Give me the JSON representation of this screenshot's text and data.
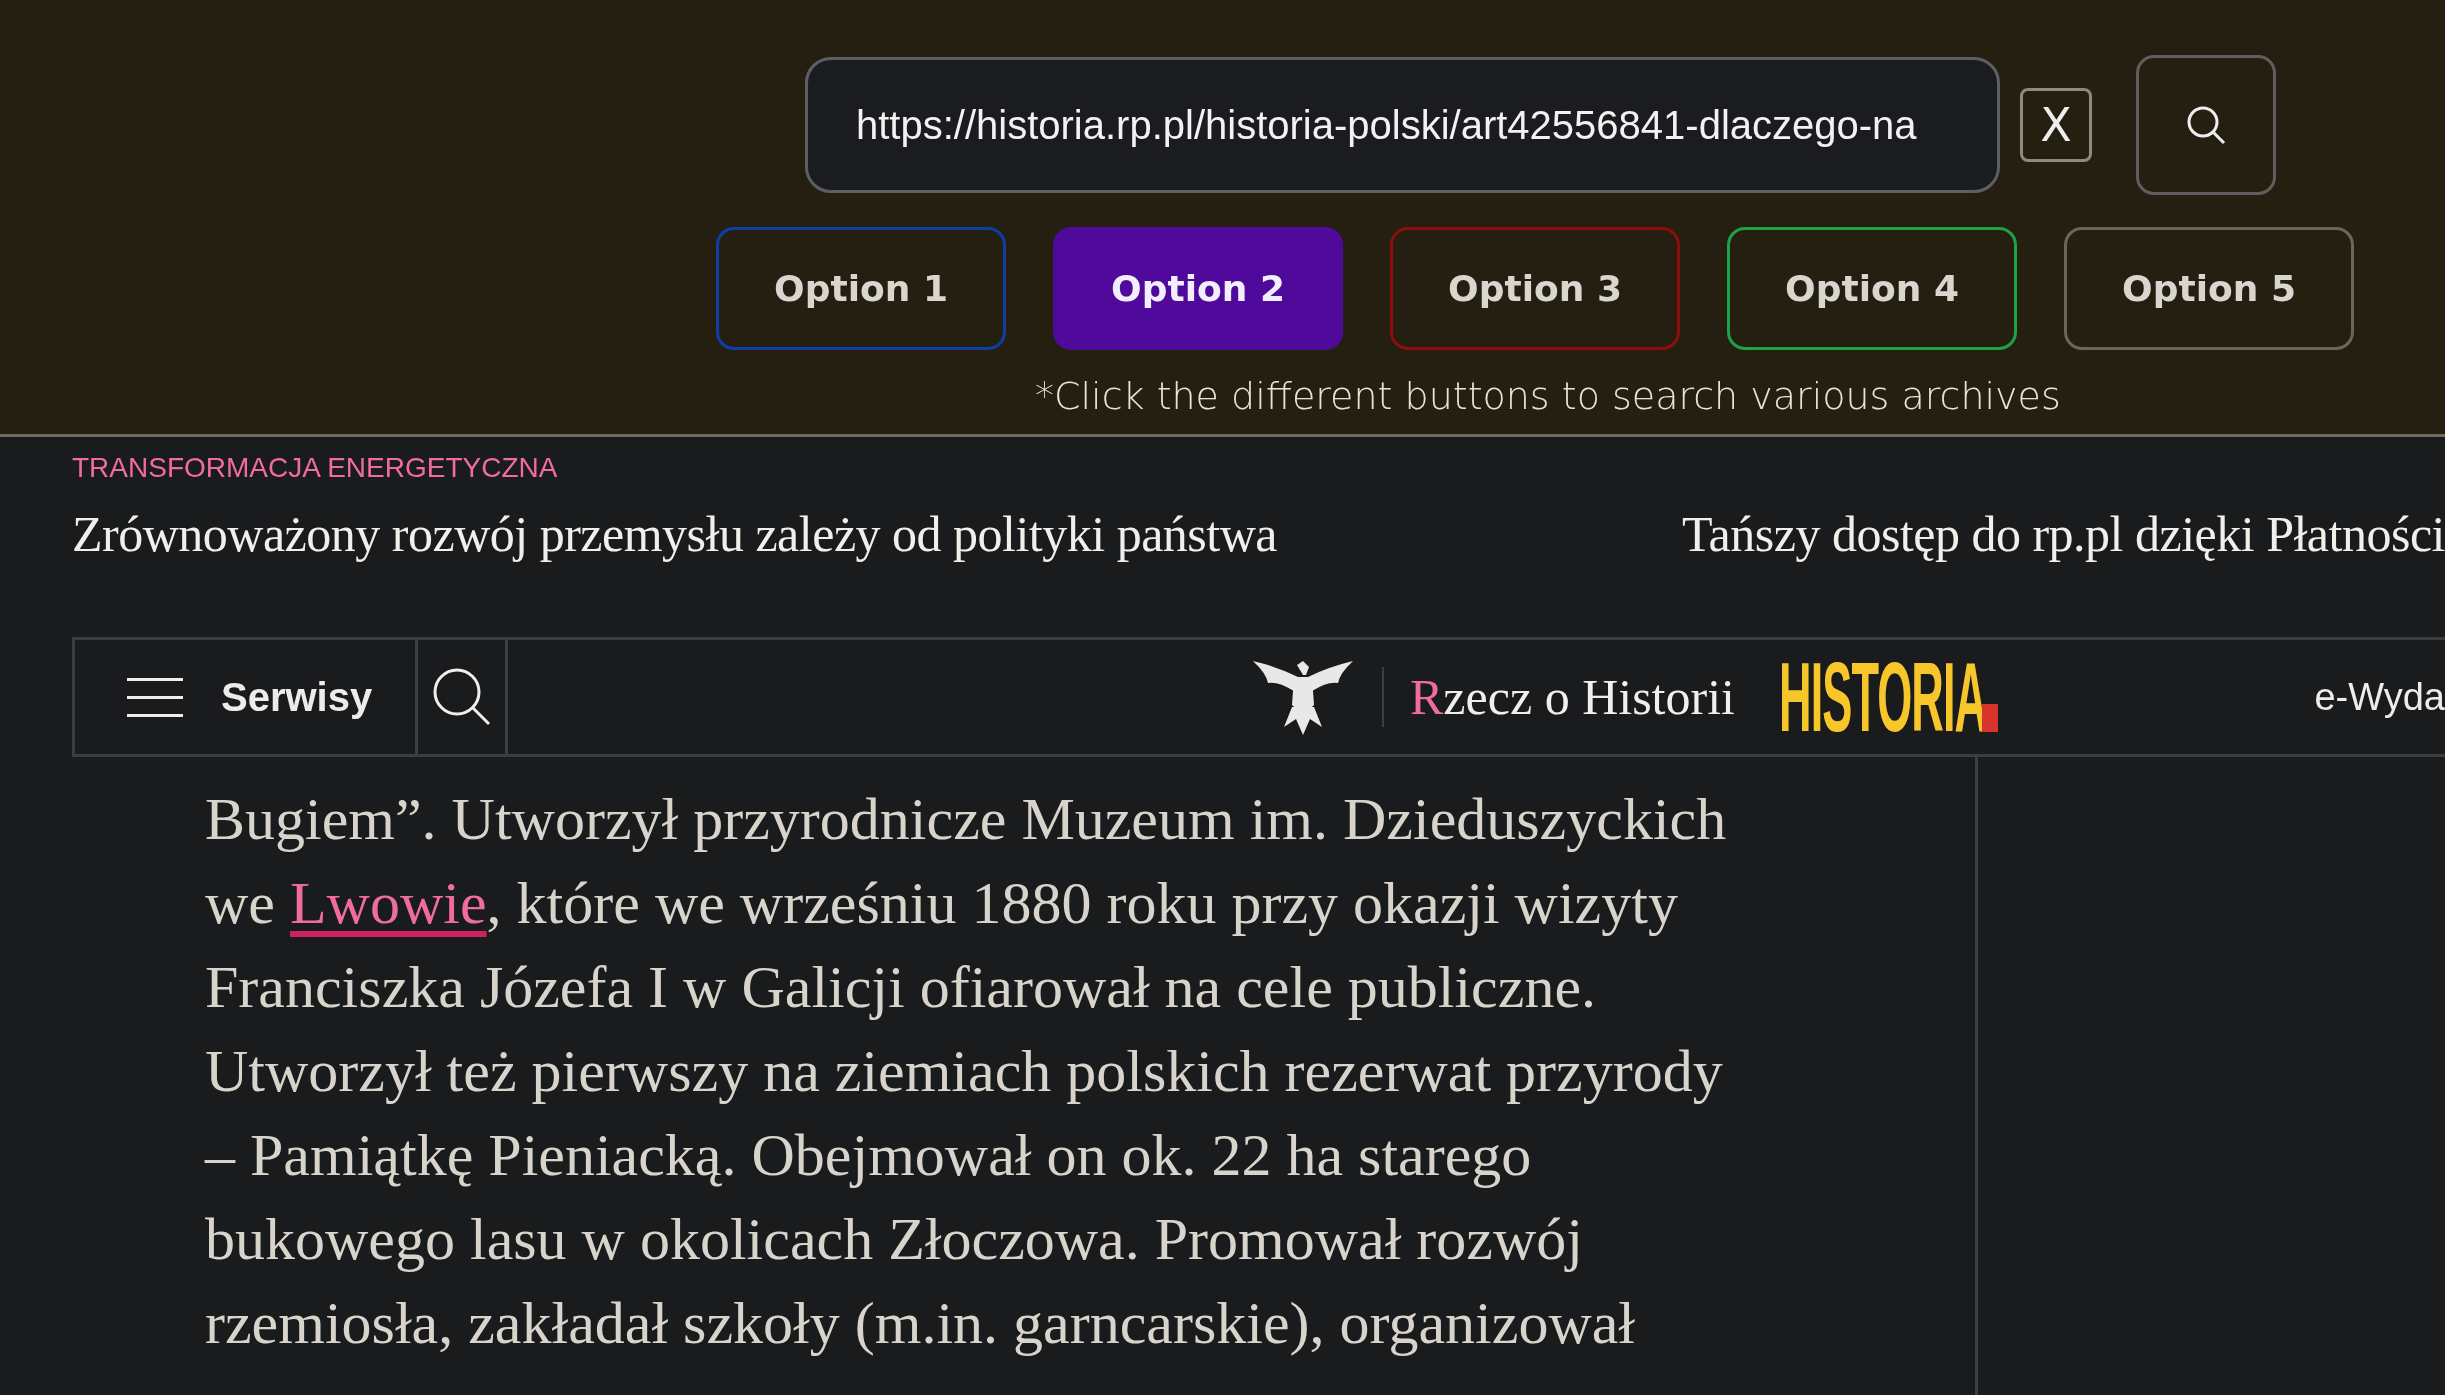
{
  "search_bar": {
    "value": "https://historia.rp.pl/historia-polski/art42556841-dlaczego-na",
    "clear_label": "X"
  },
  "options": [
    {
      "label": "Option 1",
      "selected": false,
      "color": "#0d3fa6"
    },
    {
      "label": "Option 2",
      "selected": true,
      "color": "#4f0a9c"
    },
    {
      "label": "Option 3",
      "selected": false,
      "color": "#8e0d0d"
    },
    {
      "label": "Option 4",
      "selected": false,
      "color": "#1ea344"
    },
    {
      "label": "Option 5",
      "selected": false,
      "color": "#6b655c"
    }
  ],
  "hint": "*Click the different buttons to search various archives",
  "ticker": {
    "category": "TRANSFORMACJA ENERGETYCZNA",
    "headlines": [
      "Zrównoważony rozwój przemysłu zależy od polityki państwa",
      "Tańszy dostęp do rp.pl dzięki Płatności"
    ]
  },
  "nav": {
    "menu_label": "Serwisy",
    "brand_initial": "R",
    "brand_rest": "zecz o Historii",
    "logo_text": "HISTORIA",
    "edition_label": "e-Wyda"
  },
  "article": {
    "segments": [
      {
        "kind": "text",
        "text": "Bugiem”. Utworzył przyrodnicze Muzeum im. Dzieduszyckich\nwe "
      },
      {
        "kind": "link",
        "text": "Lwowie"
      },
      {
        "kind": "text",
        "text": ", które we wrześniu 1880 roku przy okazji wizyty\nFranciszka Józefa I w Galicji ofiarował na cele publiczne.\nUtworzył też pierwszy na ziemiach polskich rezerwat przyrody\n– Pamiątkę Pieniacką. Obejmował on ok. 22 ha starego\nbukowego lasu w okolicach Złoczowa. Promował rozwój\nrzemiosła, zakładał szkoły (m.in. garncarskie), organizował"
      }
    ]
  }
}
